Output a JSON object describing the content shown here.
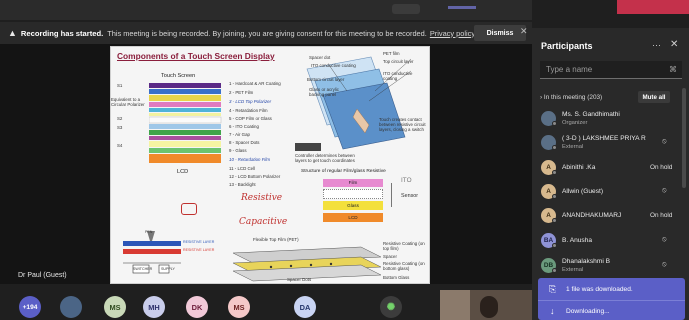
{
  "banner": {
    "title": "Recording has started.",
    "message": "This meeting is being recorded. By joining, you are giving consent for this meeting to be recorded.",
    "link": "Privacy policy",
    "dismiss": "Dismiss"
  },
  "stage": {
    "presenter": "Dr Paul (Guest)",
    "slide": {
      "title": "Components of a Touch Screen Display",
      "touch_screen_label": "Touch Screen",
      "lcd_label": "LCD",
      "left_labels": {
        "s1": "S1",
        "equivalent": "Equivalent to a Circular Polarizer",
        "s2": "S2",
        "s3": "S3",
        "s4": "S4"
      },
      "layers": [
        "1 - Hardcoat & AR Coating",
        "2 - PET Film",
        "3 - LCD Top Polarizer",
        "4 - Retardation Film",
        "5 - COP Film or Glass",
        "6 - ITO Coating",
        "7 - Air Gap",
        "8 - Spacer Dots",
        "9 - Glass",
        "10 - Retardation Film",
        "11 - LCD Cell",
        "12 - LCD Bottom Polarizer",
        "13 - Backlight"
      ],
      "diagram_labels": {
        "pet_film": "PET film",
        "top_circuit": "Top circuit layer",
        "spacer_dot": "Spacer dot",
        "ito_top": "ITO conductive coating",
        "bottom_circuit": "Bottom circuit layer",
        "ito_bottom": "ITO conductive coating",
        "glass_backing": "Glass or acrylic backing panel",
        "touch_contact": "Touch creates contact between resistive circuit layers, closing a switch",
        "controller": "Controller determines between layers to get touch coordinates"
      },
      "structure_title": "Structure of regular Film/glass Resistive",
      "stack": {
        "film": "Film",
        "glass": "Glass",
        "lcd": "LCD",
        "sensor": "Sensor",
        "ito": "ITO"
      },
      "handwriting": {
        "resistive": "Resistive",
        "capacitive": "Capacitive"
      },
      "flex_labels": {
        "flex_top": "Flexible Top Film (PET)",
        "resistive_top": "Resistive Coating (on top film)",
        "spacer": "Spacer",
        "resistive_bottom": "Resistive Coating (on bottom glass)",
        "bottom_glass": "Bottom Glass",
        "spacer_dots": "Spacer Dots"
      },
      "circuit_labels": {
        "film_label": "PEN",
        "top1": "RESISTIVE LAYER",
        "top2": "RESISTIVE LAYER",
        "switch": "SWITCHER",
        "supply": "SUPPLY"
      }
    }
  },
  "participants": {
    "title": "Participants",
    "search_placeholder": "Type a name",
    "section": "In this meeting (203)",
    "mute_all": "Mute all",
    "items": [
      {
        "initials": "",
        "name": "Ms. S. Gandhimathi",
        "role": "Organizer",
        "status": ""
      },
      {
        "initials": "",
        "name": "( 3-D ) LAKSHMEE PRIYA R",
        "role": "External",
        "status": ""
      },
      {
        "initials": "A",
        "name": "Abinithi .Ka",
        "role": "",
        "status": "On hold"
      },
      {
        "initials": "A",
        "name": "Allwin (Guest)",
        "role": "",
        "status": ""
      },
      {
        "initials": "A",
        "name": "ANANDHAKUMARJ",
        "role": "",
        "status": "On hold"
      },
      {
        "initials": "BA",
        "name": "B. Anusha",
        "role": "",
        "status": ""
      },
      {
        "initials": "DB",
        "name": "Dhanalakshmi B",
        "role": "External",
        "status": ""
      }
    ]
  },
  "toast": {
    "downloaded": "1 file was downloaded.",
    "downloading": "Downloading..."
  },
  "bottom_bar": {
    "overflow": "+194",
    "avatars": [
      "MS",
      "MH",
      "DK",
      "MS",
      "DA"
    ]
  }
}
